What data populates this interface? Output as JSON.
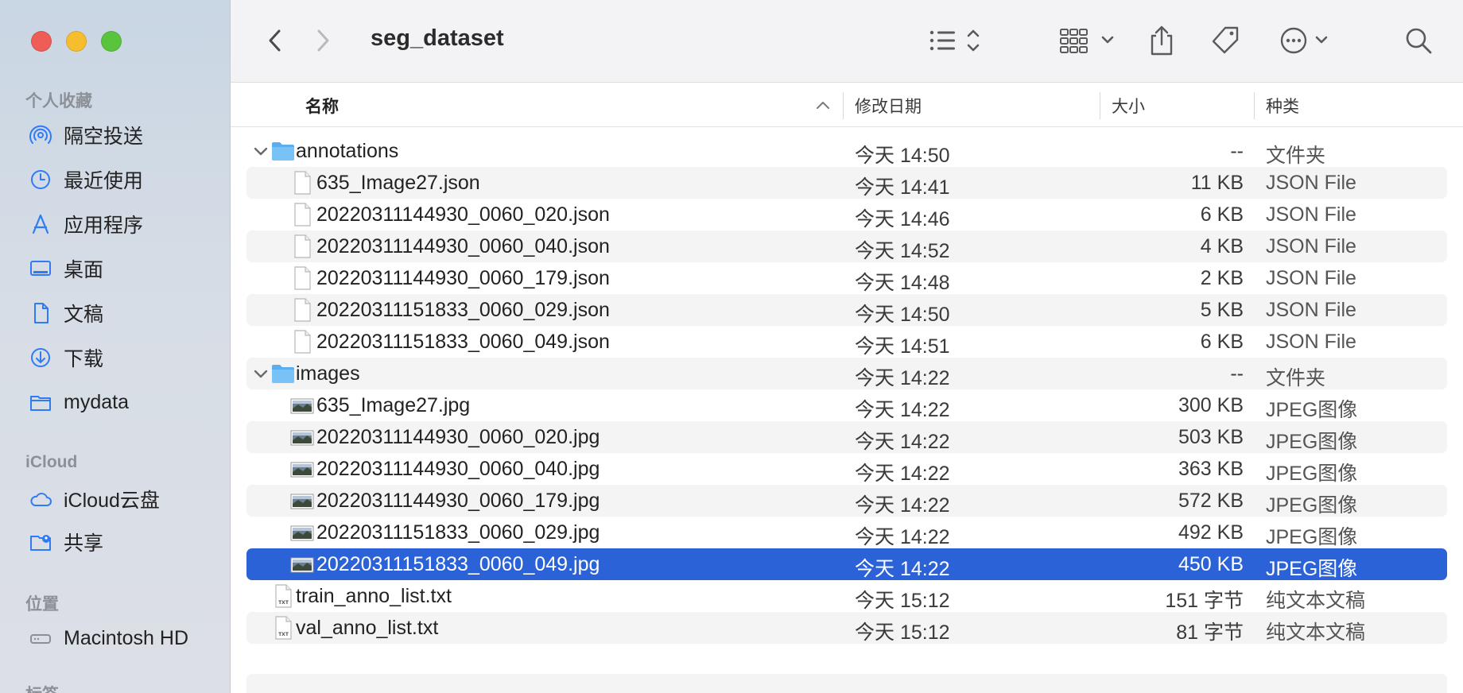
{
  "window": {
    "title": "seg_dataset"
  },
  "sidebar": {
    "favorites_header": "个人收藏",
    "favorites": [
      {
        "label": "隔空投送",
        "icon": "airdrop-icon"
      },
      {
        "label": "最近使用",
        "icon": "clock-icon"
      },
      {
        "label": "应用程序",
        "icon": "applications-icon"
      },
      {
        "label": "桌面",
        "icon": "desktop-icon"
      },
      {
        "label": "文稿",
        "icon": "document-icon"
      },
      {
        "label": "下载",
        "icon": "download-icon"
      },
      {
        "label": "mydata",
        "icon": "folder-icon"
      }
    ],
    "icloud_header": "iCloud",
    "icloud": [
      {
        "label": "iCloud云盘",
        "icon": "cloud-icon"
      },
      {
        "label": "共享",
        "icon": "shared-folder-icon"
      }
    ],
    "locations_header": "位置",
    "locations": [
      {
        "label": "Macintosh HD",
        "icon": "disk-icon"
      }
    ],
    "tags_header": "标签"
  },
  "columns": {
    "name": "名称",
    "date": "修改日期",
    "size": "大小",
    "kind": "种类"
  },
  "files": [
    {
      "name": "annotations",
      "date": "今天 14:50",
      "size": "--",
      "kind": "文件夹",
      "type": "folder",
      "level": 0,
      "expanded": true
    },
    {
      "name": "635_Image27.json",
      "date": "今天 14:41",
      "size": "11 KB",
      "kind": "JSON File",
      "type": "doc",
      "level": 1
    },
    {
      "name": "20220311144930_0060_020.json",
      "date": "今天 14:46",
      "size": "6 KB",
      "kind": "JSON File",
      "type": "doc",
      "level": 1
    },
    {
      "name": "20220311144930_0060_040.json",
      "date": "今天 14:52",
      "size": "4 KB",
      "kind": "JSON File",
      "type": "doc",
      "level": 1
    },
    {
      "name": "20220311144930_0060_179.json",
      "date": "今天 14:48",
      "size": "2 KB",
      "kind": "JSON File",
      "type": "doc",
      "level": 1
    },
    {
      "name": "20220311151833_0060_029.json",
      "date": "今天 14:50",
      "size": "5 KB",
      "kind": "JSON File",
      "type": "doc",
      "level": 1
    },
    {
      "name": "20220311151833_0060_049.json",
      "date": "今天 14:51",
      "size": "6 KB",
      "kind": "JSON File",
      "type": "doc",
      "level": 1
    },
    {
      "name": "images",
      "date": "今天 14:22",
      "size": "--",
      "kind": "文件夹",
      "type": "folder",
      "level": 0,
      "expanded": true
    },
    {
      "name": "635_Image27.jpg",
      "date": "今天 14:22",
      "size": "300 KB",
      "kind": "JPEG图像",
      "type": "image",
      "level": 1
    },
    {
      "name": "20220311144930_0060_020.jpg",
      "date": "今天 14:22",
      "size": "503 KB",
      "kind": "JPEG图像",
      "type": "image",
      "level": 1
    },
    {
      "name": "20220311144930_0060_040.jpg",
      "date": "今天 14:22",
      "size": "363 KB",
      "kind": "JPEG图像",
      "type": "image",
      "level": 1
    },
    {
      "name": "20220311144930_0060_179.jpg",
      "date": "今天 14:22",
      "size": "572 KB",
      "kind": "JPEG图像",
      "type": "image",
      "level": 1
    },
    {
      "name": "20220311151833_0060_029.jpg",
      "date": "今天 14:22",
      "size": "492 KB",
      "kind": "JPEG图像",
      "type": "image",
      "level": 1
    },
    {
      "name": "20220311151833_0060_049.jpg",
      "date": "今天 14:22",
      "size": "450 KB",
      "kind": "JPEG图像",
      "type": "image",
      "level": 1,
      "selected": true
    },
    {
      "name": "train_anno_list.txt",
      "date": "今天 15:12",
      "size": "151 字节",
      "kind": "纯文本文稿",
      "type": "txt",
      "level": 0
    },
    {
      "name": "val_anno_list.txt",
      "date": "今天 15:12",
      "size": "81 字节",
      "kind": "纯文本文稿",
      "type": "txt",
      "level": 0
    }
  ],
  "colors": {
    "selection": "#2b62d8",
    "accent_icon": "#2f7bf6",
    "folder": "#6cb8f3"
  }
}
